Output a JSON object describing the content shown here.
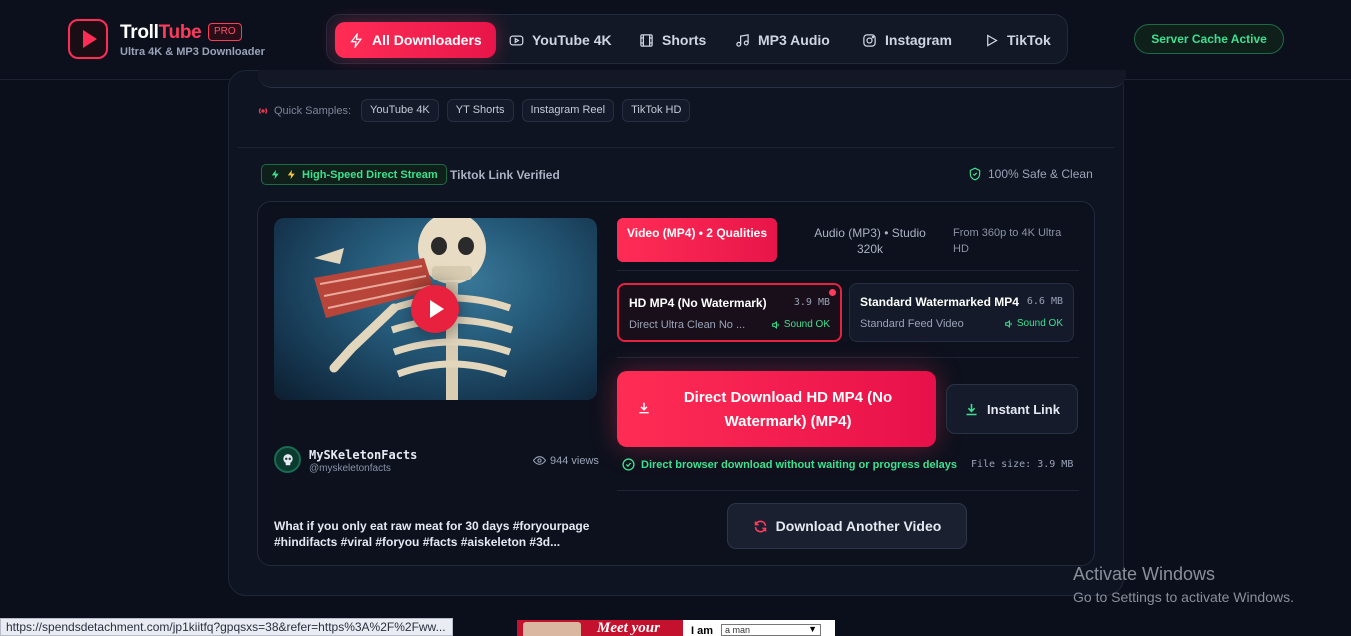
{
  "header": {
    "brand_part1": "Troll",
    "brand_part2": "Tube",
    "badge": "PRO",
    "tagline": "Ultra 4K & MP3 Downloader",
    "cache_status": "Server Cache Active",
    "nav": [
      {
        "label": "All Downloaders",
        "icon": "bolt-icon",
        "active": true
      },
      {
        "label": "YouTube 4K",
        "icon": "youtube-icon"
      },
      {
        "label": "Shorts",
        "icon": "film-icon"
      },
      {
        "label": "MP3 Audio",
        "icon": "music-icon"
      },
      {
        "label": "Instagram",
        "icon": "instagram-icon"
      },
      {
        "label": "TikTok",
        "icon": "play-outline-icon"
      }
    ]
  },
  "samples": {
    "label": "Quick Samples:",
    "chips": [
      "YouTube 4K",
      "YT Shorts",
      "Instagram Reel",
      "TikTok HD"
    ]
  },
  "status": {
    "fast_badge": "High-Speed Direct Stream",
    "verified": "Tiktok Link Verified",
    "safe": "100% Safe & Clean"
  },
  "video": {
    "channel_name": "MySKeletonFacts",
    "channel_handle": "@myskeletonfacts",
    "views": "944 views",
    "caption": "What if you only eat raw meat for 30 days #foryourpage #hindifacts #viral #foryou #facts #aiskeleton #3d..."
  },
  "formats": {
    "video_tab": "Video (MP4) • 2 Qualities",
    "audio_tab": "Audio (MP3) • Studio 320k",
    "note": "From 360p to 4K Ultra HD"
  },
  "qualities": [
    {
      "title": "HD MP4 (No Watermark)",
      "size": "3.9 MB",
      "sub": "Direct Ultra Clean No ...",
      "sound": "Sound OK",
      "selected": true
    },
    {
      "title": "Standard Watermarked MP4",
      "size": "6.6 MB",
      "sub": "Standard Feed Video",
      "sound": "Sound OK",
      "selected": false
    }
  ],
  "actions": {
    "download": "Direct Download HD MP4 (No Watermark) (MP4)",
    "instant": "Instant Link",
    "direct_note": "Direct browser download without waiting or progress delays",
    "file_size": "File size: 3.9 MB",
    "again": "Download Another Video"
  },
  "overlay": {
    "activate_title": "Activate Windows",
    "activate_sub": "Go to Settings to activate Windows.",
    "status_url": "https://spendsdetachment.com/jp1kiitfq?gpqsxs=38&refer=https%3A%2F%2Fww...",
    "ad_headline": "Meet your",
    "ad_label": "I am",
    "ad_select": "a man"
  },
  "colors": {
    "accent": "#ff2d55",
    "success": "#3ee08f",
    "background": "#0b0f1c"
  }
}
